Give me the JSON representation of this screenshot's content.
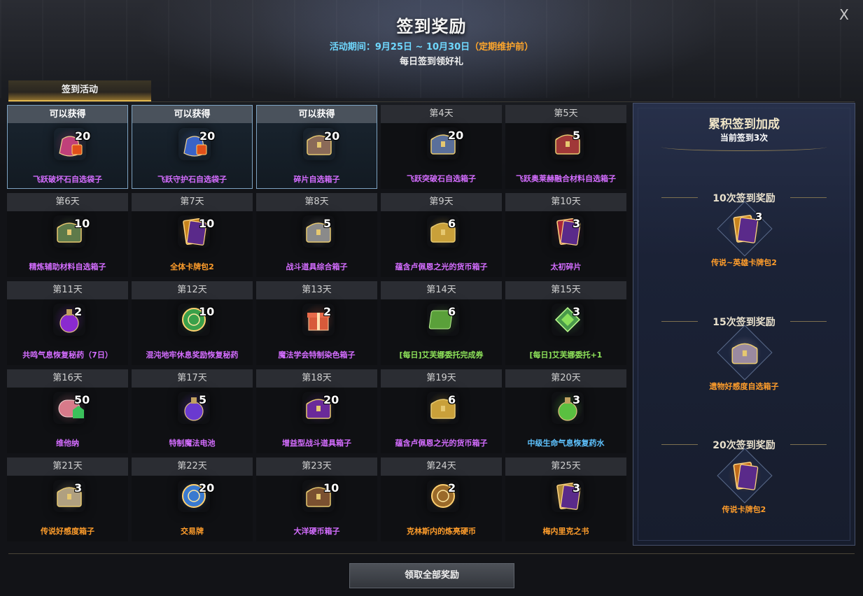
{
  "header": {
    "title": "签到奖励",
    "period": "活动期间：9月25日 ~ 10月30日",
    "period_note": "（定期维护前）",
    "subtitle": "每日签到领好礼",
    "close_label": "X"
  },
  "tab": {
    "label": "签到活动"
  },
  "rewards": [
    {
      "day": "可以获得",
      "qty": "20",
      "name": "飞跃破坏石自选袋子",
      "color": "purple",
      "icon": "pink-pouch-icon",
      "hue": "#c0407a",
      "obtainable": true
    },
    {
      "day": "可以获得",
      "qty": "20",
      "name": "飞跃守护石自选袋子",
      "color": "purple",
      "icon": "blue-pouch-icon",
      "hue": "#3a63c8",
      "obtainable": true
    },
    {
      "day": "可以获得",
      "qty": "20",
      "name": "碎片自选箱子",
      "color": "purple",
      "icon": "shard-chest-icon",
      "hue": "#8a6a58",
      "obtainable": true
    },
    {
      "day": "第4天",
      "qty": "20",
      "name": "飞跃突破石自选箱子",
      "color": "purple",
      "icon": "breakthrough-chest-icon",
      "hue": "#5a6f9a",
      "obtainable": false
    },
    {
      "day": "第5天",
      "qty": "5",
      "name": "飞跃奥莱赫融合材料自选箱子",
      "color": "purple",
      "icon": "red-chest-icon",
      "hue": "#a03838",
      "obtainable": false
    },
    {
      "day": "第6天",
      "qty": "10",
      "name": "精炼辅助材料自选箱子",
      "color": "purple",
      "icon": "green-chest-icon",
      "hue": "#5e7a4a",
      "obtainable": false
    },
    {
      "day": "第7天",
      "qty": "10",
      "name": "全体卡牌包2",
      "color": "orange",
      "icon": "card-pack-icon",
      "hue": "#c7831e",
      "obtainable": false
    },
    {
      "day": "第8天",
      "qty": "5",
      "name": "战斗道具综合箱子",
      "color": "purple",
      "icon": "battle-chest-icon",
      "hue": "#8a8a8a",
      "obtainable": false
    },
    {
      "day": "第9天",
      "qty": "6",
      "name": "蕴含卢佩恩之光的货币箱子",
      "color": "purple",
      "icon": "gold-chest-icon",
      "hue": "#c9a03a",
      "obtainable": false
    },
    {
      "day": "第10天",
      "qty": "3",
      "name": "太初碎片",
      "color": "purple",
      "icon": "card-fragment-icon",
      "hue": "#a8263a",
      "obtainable": false
    },
    {
      "day": "第11天",
      "qty": "2",
      "name": "共鸣气息恢复秘药（7日）",
      "color": "purple",
      "icon": "purple-potion-icon",
      "hue": "#8a2ad0",
      "obtainable": false
    },
    {
      "day": "第12天",
      "qty": "10",
      "name": "混沌地牢休息奖励恢复秘药",
      "color": "purple",
      "icon": "green-orb-icon",
      "hue": "#3aa04a",
      "obtainable": false
    },
    {
      "day": "第13天",
      "qty": "2",
      "name": "魔法学会特制染色箱子",
      "color": "purple",
      "icon": "gift-box-icon",
      "hue": "#d85a3a",
      "obtainable": false
    },
    {
      "day": "第14天",
      "qty": "6",
      "name": "[每日]艾芙娜委托完成券",
      "color": "green",
      "icon": "green-scroll-icon",
      "hue": "#5aa03a",
      "obtainable": false
    },
    {
      "day": "第15天",
      "qty": "3",
      "name": "[每日]艾芙娜委托+1",
      "color": "green",
      "icon": "green-emblem-icon",
      "hue": "#4a9a4a",
      "obtainable": false
    },
    {
      "day": "第16天",
      "qty": "50",
      "name": "维他纳",
      "color": "purple",
      "icon": "can-icon",
      "hue": "#d87a8a",
      "obtainable": false
    },
    {
      "day": "第17天",
      "qty": "5",
      "name": "特制魔法电池",
      "color": "purple",
      "icon": "battery-icon",
      "hue": "#6a3ad0",
      "obtainable": false
    },
    {
      "day": "第18天",
      "qty": "20",
      "name": "增益型战斗道具箱子",
      "color": "purple",
      "icon": "purple-chest-icon",
      "hue": "#6a2a9a",
      "obtainable": false
    },
    {
      "day": "第19天",
      "qty": "6",
      "name": "蕴含卢佩恩之光的货币箱子",
      "color": "purple",
      "icon": "gold-chest-icon",
      "hue": "#c9a03a",
      "obtainable": false
    },
    {
      "day": "第20天",
      "qty": "3",
      "name": "中级生命气息恢复药水",
      "color": "blue",
      "icon": "green-potion-icon",
      "hue": "#5ac040",
      "obtainable": false
    },
    {
      "day": "第21天",
      "qty": "3",
      "name": "传说好感度箱子",
      "color": "orange",
      "icon": "heart-chest-icon",
      "hue": "#b0a080",
      "obtainable": false
    },
    {
      "day": "第22天",
      "qty": "20",
      "name": "交易牌",
      "color": "orange",
      "icon": "trade-token-icon",
      "hue": "#3a7ad0",
      "obtainable": false
    },
    {
      "day": "第23天",
      "qty": "10",
      "name": "大洋硬币箱子",
      "color": "purple",
      "icon": "ocean-chest-icon",
      "hue": "#7a5030",
      "obtainable": false
    },
    {
      "day": "第24天",
      "qty": "2",
      "name": "克林斯内的炼亮硬币",
      "color": "orange",
      "icon": "gold-coin-icon",
      "hue": "#9a6a2a",
      "obtainable": false
    },
    {
      "day": "第25天",
      "qty": "3",
      "name": "梅内里克之书",
      "color": "orange",
      "icon": "book-icon",
      "hue": "#b08a3a",
      "obtainable": false
    }
  ],
  "sidebar": {
    "title": "累积签到加成",
    "current": "当前签到3次",
    "milestones": [
      {
        "label": "10次签到奖励",
        "qty": "3",
        "name": "传说~英雄卡牌包2",
        "icon": "card-pack-icon",
        "hue": "#c7831e"
      },
      {
        "label": "15次签到奖励",
        "qty": "",
        "name": "遗物好感度自选箱子",
        "icon": "heart-chest-icon",
        "hue": "#9a8aa0"
      },
      {
        "label": "20次签到奖励",
        "qty": "",
        "name": "传说卡牌包2",
        "icon": "book-icon",
        "hue": "#c06a1a"
      }
    ]
  },
  "footer": {
    "claim_all": "领取全部奖励"
  }
}
